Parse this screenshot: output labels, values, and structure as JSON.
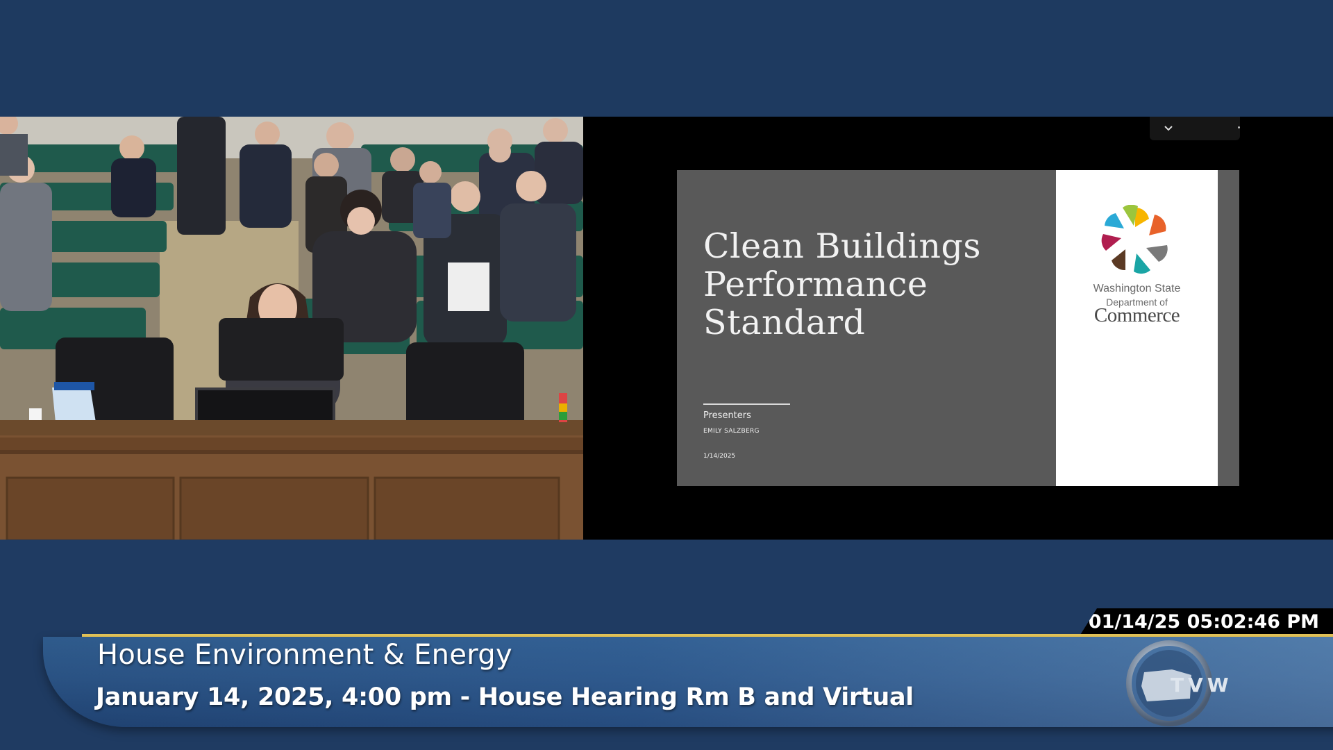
{
  "slide": {
    "title_lines": [
      "Clean Buildings",
      "Performance",
      "Standard"
    ],
    "presenters_label": "Presenters",
    "presenter_name": "EMILY SALZBERG",
    "date": "1/14/2025",
    "logo": {
      "line1": "Washington State",
      "line2": "Department of",
      "line3": "Commerce",
      "petal_colors": [
        "#f7b500",
        "#e8622a",
        "#7a7a7a",
        "#1aa5a5",
        "#5b3a24",
        "#b01e4f",
        "#2aa9d6",
        "#9bc53d"
      ]
    }
  },
  "broadcast": {
    "timestamp": "01/14/25 05:02:46 PM",
    "program_title": "House Environment & Energy",
    "program_subtitle": "January 14, 2025, 4:00 pm - House Hearing Rm B and Virtual",
    "logo_text": "TVW"
  },
  "colors": {
    "background": "#1f3b62",
    "accent_gold": "#e8c75a",
    "slide_gray": "#595959"
  }
}
